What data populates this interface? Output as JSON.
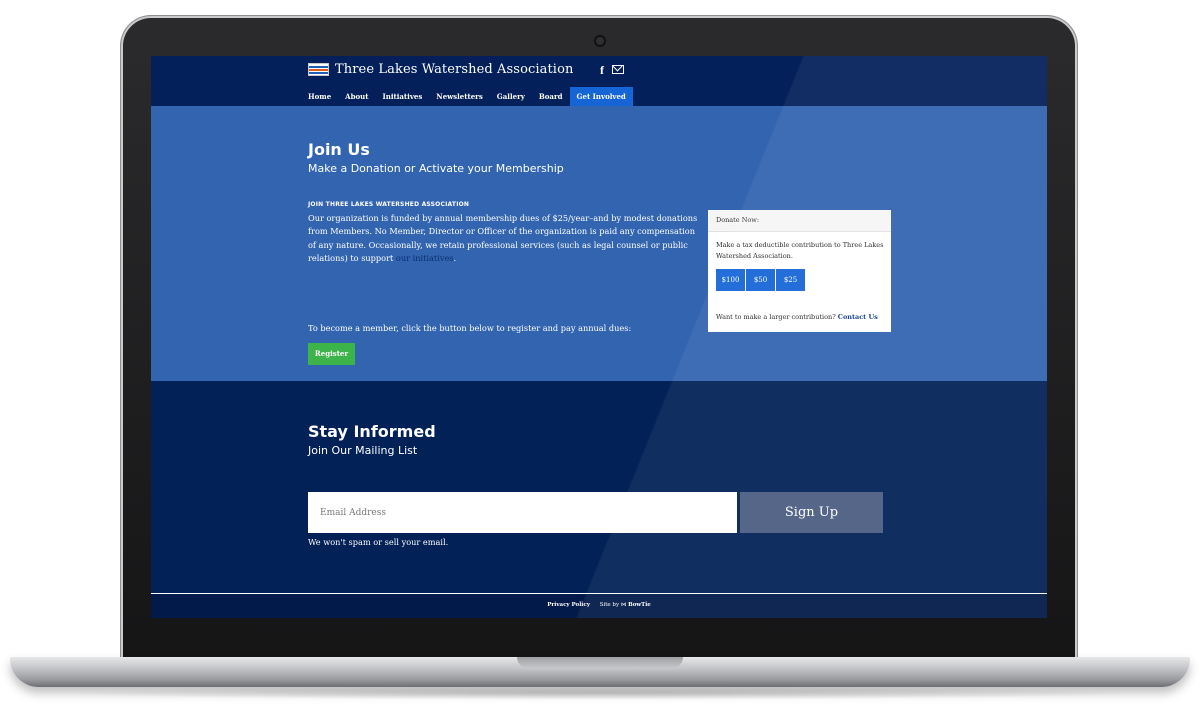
{
  "header": {
    "site_name": "Three Lakes Watershed Association",
    "facebook_glyph": "f",
    "flag_icon": "flag-icon",
    "mail_icon": "mail-icon"
  },
  "nav": {
    "items": [
      "Home",
      "About",
      "Initiatives",
      "Newsletters",
      "Gallery",
      "Board",
      "Get Involved"
    ],
    "active": "Get Involved"
  },
  "join": {
    "title": "Join Us",
    "subtitle": "Make a Donation or Activate your Membership",
    "section_heading": "JOIN THREE LAKES WATERSHED ASSOCIATION",
    "body_before_link": "Our organization is funded by annual membership dues of $25/year–and by modest donations from Members. No Member, Director or Officer of the organization is paid any compensation of any nature. Occasionally, we retain professional services (such as legal counsel or public relations) to support ",
    "body_link": "our initiatives",
    "body_after_link": ".",
    "member_text": "To become a member, click the button below to register and pay annual dues:",
    "register_label": "Register"
  },
  "donate": {
    "header": "Donate Now:",
    "text": "Make a tax deductible contribution to Three Lakes Watershed Association.",
    "amounts": [
      "$100",
      "$50",
      "$25"
    ],
    "larger_text": "Want to make a larger contribution?",
    "contact_label": "Contact Us"
  },
  "stay": {
    "title": "Stay Informed",
    "subtitle": "Join Our Mailing List",
    "email_placeholder": "Email Address",
    "signup_label": "Sign Up",
    "nospam": "We won't spam or sell your email."
  },
  "footer": {
    "privacy": "Privacy Policy",
    "site_by": "Site by",
    "bowtie": "BowTie"
  },
  "colors": {
    "navy": "#022157",
    "join_blue": "#3364b0",
    "accent_blue": "#1565d6",
    "register_green": "#3db449",
    "signup_gray": "#4b5d82"
  }
}
